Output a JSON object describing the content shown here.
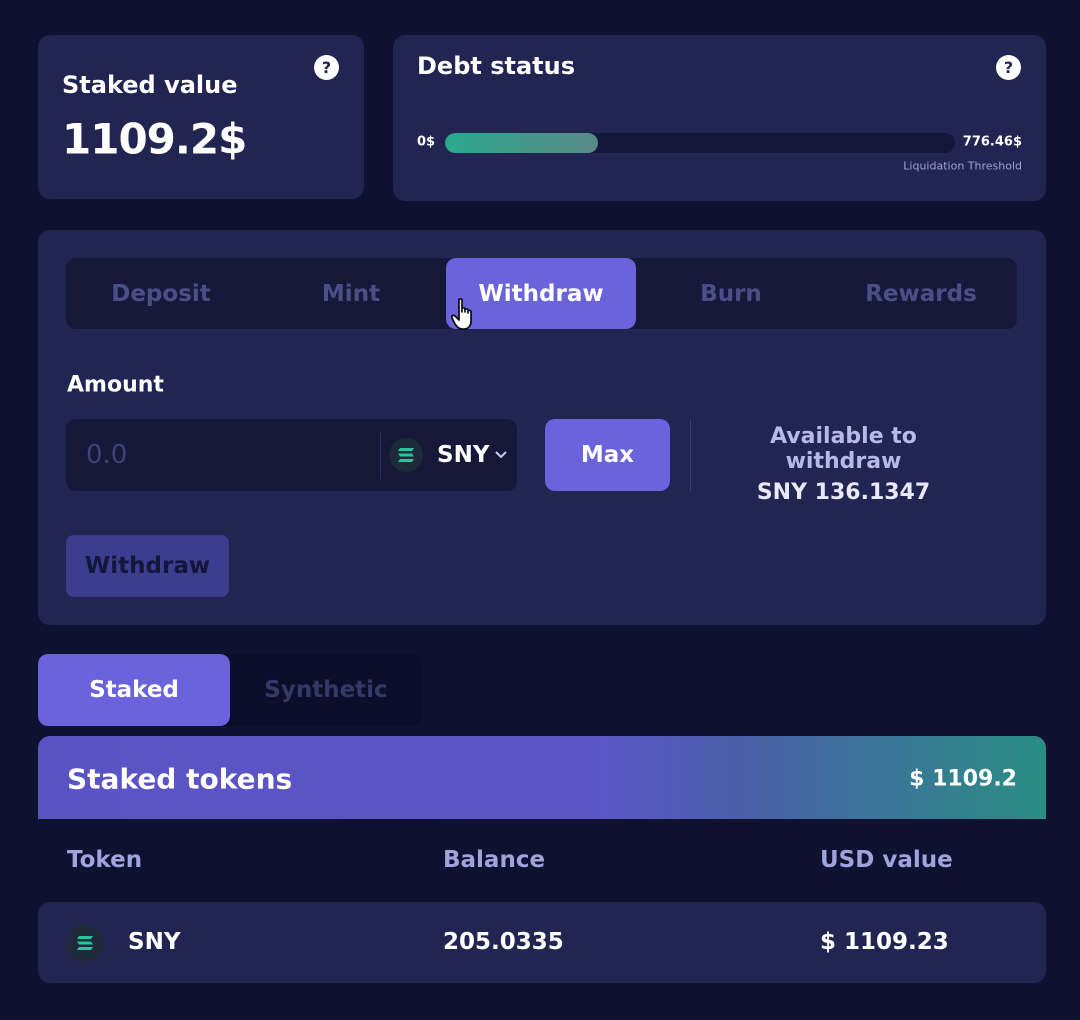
{
  "staked_value": {
    "title": "Staked value",
    "value": "1109.2$",
    "help": "?"
  },
  "debt_status": {
    "title": "Debt status",
    "help": "?",
    "min_label": "0$",
    "max_label": "776.46$",
    "threshold_label": "Liquidation Threshold",
    "progress": 0.3
  },
  "action_tabs": [
    "Deposit",
    "Mint",
    "Withdraw",
    "Burn",
    "Rewards"
  ],
  "active_action_tab": "Withdraw",
  "amount": {
    "label": "Amount",
    "placeholder": "0.0",
    "token": "SNY",
    "max_label": "Max",
    "available_label": "Available to withdraw",
    "available_value": "SNY 136.1347",
    "submit_label": "Withdraw"
  },
  "lower_tabs": [
    "Staked",
    "Synthetic"
  ],
  "active_lower_tab": "Staked",
  "staked_tokens": {
    "title": "Staked tokens",
    "total": "$ 1109.2",
    "columns": [
      "Token",
      "Balance",
      "USD value"
    ],
    "rows": [
      {
        "token": "SNY",
        "balance": "205.0335",
        "usd": "$ 1109.23"
      }
    ]
  },
  "colors": {
    "accent": "#6b63dc",
    "teal": "#2aa98e",
    "card": "#222552",
    "background": "#0f1131"
  }
}
